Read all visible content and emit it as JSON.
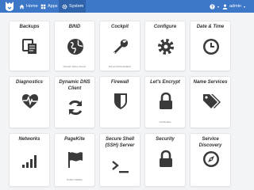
{
  "nav": {
    "home": "Home",
    "apps": "Apps",
    "system": "System",
    "help_caret": "▾",
    "user": "admin",
    "user_caret": "▾"
  },
  "cards": [
    {
      "title": "Backups",
      "desc": "",
      "icon": "copy-icon"
    },
    {
      "title": "BIND",
      "desc": "Domain Name Server",
      "icon": "globe-icon"
    },
    {
      "title": "Cockpit",
      "desc": "Server Administration",
      "icon": "wrench-icon"
    },
    {
      "title": "Configure",
      "desc": "",
      "icon": "gear-icon"
    },
    {
      "title": "Date & Time",
      "desc": "",
      "icon": "clock-icon"
    },
    {
      "title": "Diagnostics",
      "desc": "",
      "icon": "heartbeat-icon"
    },
    {
      "title": "Dynamic DNS Client",
      "desc": "",
      "icon": "refresh-icon"
    },
    {
      "title": "Firewall",
      "desc": "",
      "icon": "shield-icon"
    },
    {
      "title": "Let's Encrypt",
      "desc": "Certificates",
      "icon": "lock-icon"
    },
    {
      "title": "Name Services",
      "desc": "",
      "icon": "tags-icon"
    },
    {
      "title": "Networks",
      "desc": "",
      "icon": "signal-icon"
    },
    {
      "title": "PageKite",
      "desc": "Public Visibility",
      "icon": "flag-icon"
    },
    {
      "title": "Secure Shell (SSH) Server",
      "desc": "",
      "icon": "terminal-icon"
    },
    {
      "title": "Security",
      "desc": "",
      "icon": "lock-icon"
    },
    {
      "title": "Service Discovery",
      "desc": "",
      "icon": "compass-icon"
    }
  ]
}
